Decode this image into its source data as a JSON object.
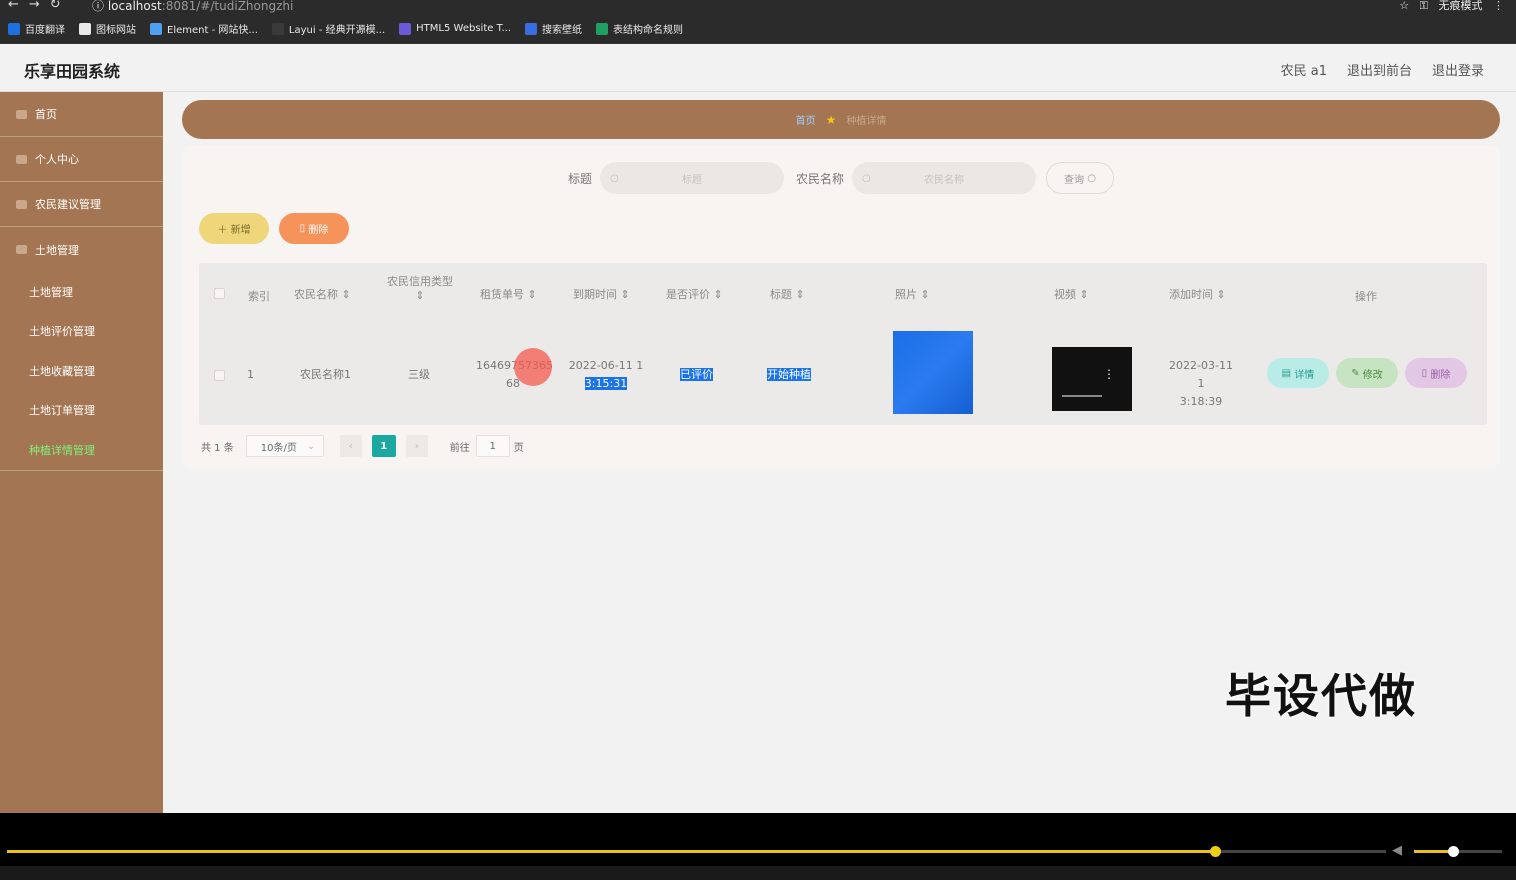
{
  "browser": {
    "url_host": "localhost",
    "url_rest": ":8081/#/tudiZhongzhi",
    "mode_label": "无痕模式",
    "bookmarks": [
      {
        "label": "百度翻译",
        "color": "#1e6fe0"
      },
      {
        "label": "图标网站",
        "color": "#e8e8e8"
      },
      {
        "label": "Element - 网站快...",
        "color": "#4ea1f0"
      },
      {
        "label": "Layui - 经典开源模...",
        "color": "#3a3a3a"
      },
      {
        "label": "HTML5 Website T...",
        "color": "#6a5ad8"
      },
      {
        "label": "搜索壁纸",
        "color": "#3a6ee0"
      },
      {
        "label": "表结构命名规则",
        "color": "#1da060"
      }
    ]
  },
  "header": {
    "title": "乐享田园系统",
    "user": "农民 a1",
    "front_link": "退出到前台",
    "logout_link": "退出登录"
  },
  "sidebar": {
    "items": [
      "首页",
      "个人中心",
      "农民建议管理",
      "土地管理"
    ],
    "subitems": [
      "土地管理",
      "土地评价管理",
      "土地收藏管理",
      "土地订单管理",
      "种植详情管理"
    ],
    "active_index": 4
  },
  "breadcrumb": {
    "home": "首页",
    "current": "种植详情"
  },
  "search": {
    "title_label": "标题",
    "title_placeholder": "标题",
    "farmer_label": "农民名称",
    "farmer_placeholder": "农民名称",
    "query_label": "查询"
  },
  "actions": {
    "add_label": "新增",
    "delete_label": "删除"
  },
  "table": {
    "headers": [
      "索引",
      "农民名称",
      "农民信用类型",
      "租赁单号",
      "到期时间",
      "是否评价",
      "标题",
      "照片",
      "视频",
      "添加时间",
      "操作"
    ],
    "rows": [
      {
        "index": "1",
        "farmer_name": "农民名称1",
        "credit_type": "三级",
        "order_no_a": "16469757365",
        "order_no_b": "68",
        "expire_a": "2022-06-11 1",
        "expire_b": "3:15:31",
        "evaluated": "已评价",
        "title": "开始种植",
        "added_a": "2022-03-11 1",
        "added_b": "3:18:39",
        "op_detail": "详情",
        "op_edit": "修改",
        "op_delete": "删除"
      }
    ]
  },
  "pager": {
    "total": "共 1 条",
    "page_size": "10条/页",
    "current_page": "1",
    "goto_label": "前往",
    "goto_value": "1",
    "page_suffix": "页"
  },
  "watermark": "毕设代做",
  "player": {
    "progress": 0.8,
    "volume": 0.45
  }
}
